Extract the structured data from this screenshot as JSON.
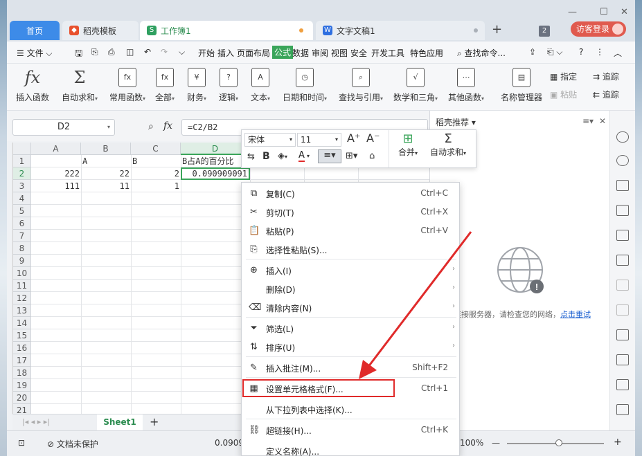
{
  "tabs": [
    {
      "label": "首页"
    },
    {
      "label": "稻壳模板"
    },
    {
      "label": "工作簿1"
    },
    {
      "label": "文字文稿1"
    }
  ],
  "title_right": {
    "badge": "2",
    "login": "访客登录"
  },
  "menubar": {
    "file": "文件",
    "items": [
      "开始",
      "插入",
      "页面布局",
      "公式",
      "数据",
      "审阅",
      "视图",
      "安全",
      "开发工具",
      "特色应用"
    ],
    "active": "公式",
    "search": "查找命令..."
  },
  "ribbon": {
    "insert_func": "插入函数",
    "autosum": "自动求和",
    "common": "常用函数",
    "all": "全部",
    "finance": "财务",
    "logic": "逻辑",
    "text": "文本",
    "datetime": "日期和时间",
    "lookup": "查找与引用",
    "math": "数学和三角",
    "other": "其他函数",
    "name_mgr": "名称管理器",
    "define": "指定",
    "paste": "粘贴",
    "trace1": "追踪",
    "trace2": "追踪"
  },
  "formula_bar": {
    "cell_ref": "D2",
    "fx": "fx",
    "formula": "=C2/B2"
  },
  "grid": {
    "columns": [
      "A",
      "B",
      "C",
      "D"
    ],
    "rows": [
      "1",
      "2",
      "3",
      "4",
      "5",
      "6",
      "7",
      "8",
      "9",
      "10",
      "11",
      "12",
      "13",
      "14",
      "15",
      "16",
      "17",
      "18",
      "19",
      "20",
      "21"
    ],
    "cells": {
      "B1": "A",
      "C1": "B",
      "D1": "B占A的百分比",
      "A2": "222",
      "B2": "22",
      "C2": "2",
      "D2": "0.090909091",
      "A3": "111",
      "B3": "11",
      "C3": "1"
    }
  },
  "sheet": {
    "name": "Sheet1",
    "add": "+"
  },
  "status": {
    "protect": "文档未保护",
    "value": "0.0909",
    "zoom": "100%"
  },
  "panel": {
    "title": "稻壳推荐",
    "message": "连接服务器，请检查您的网络，",
    "retry": "点击重试"
  },
  "mini_toolbar": {
    "font": "宋体",
    "size": "11",
    "merge": "合并",
    "autosum": "自动求和"
  },
  "context_menu": [
    {
      "label": "复制(C)",
      "shortcut": "Ctrl+C",
      "icon": "copy-icon"
    },
    {
      "label": "剪切(T)",
      "shortcut": "Ctrl+X",
      "icon": "scissors-icon"
    },
    {
      "label": "粘贴(P)",
      "shortcut": "Ctrl+V",
      "icon": "paste-icon"
    },
    {
      "label": "选择性粘贴(S)...",
      "shortcut": "",
      "icon": "paste-special-icon"
    },
    {
      "label": "插入(I)",
      "shortcut": "",
      "icon": "insert-icon",
      "submenu": true
    },
    {
      "label": "删除(D)",
      "shortcut": "",
      "icon": "",
      "submenu": true
    },
    {
      "label": "清除内容(N)",
      "shortcut": "",
      "icon": "eraser-icon",
      "submenu": true
    },
    {
      "label": "筛选(L)",
      "shortcut": "",
      "icon": "filter-icon",
      "submenu": true
    },
    {
      "label": "排序(U)",
      "shortcut": "",
      "icon": "sort-icon",
      "submenu": true
    },
    {
      "label": "插入批注(M)...",
      "shortcut": "Shift+F2",
      "icon": "comment-icon"
    },
    {
      "label": "设置单元格格式(F)...",
      "shortcut": "Ctrl+1",
      "icon": "format-cells-icon"
    },
    {
      "label": "从下拉列表中选择(K)...",
      "shortcut": "",
      "icon": ""
    },
    {
      "label": "超链接(H)...",
      "shortcut": "Ctrl+K",
      "icon": "link-icon"
    },
    {
      "label": "定义名称(A)...",
      "shortcut": "",
      "icon": ""
    }
  ],
  "colors": {
    "accent_green": "#3aa55a",
    "highlight_red": "#e02a2a",
    "tab_blue": "#3d8be8"
  }
}
